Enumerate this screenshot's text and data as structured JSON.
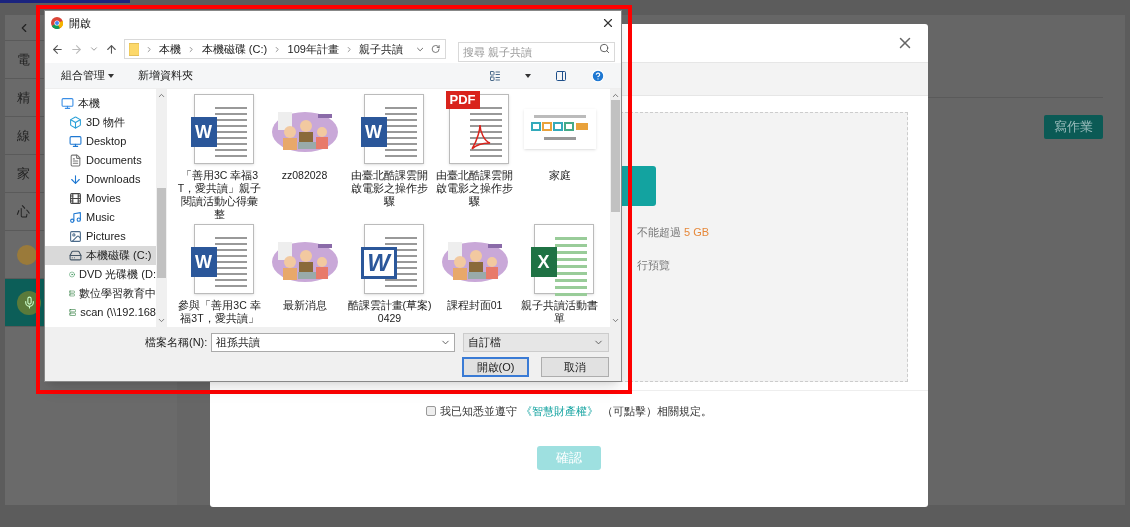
{
  "sidebar": [
    {
      "label": "電",
      "kind": "text",
      "selected": false
    },
    {
      "label": "精",
      "kind": "text",
      "selected": false
    },
    {
      "label": "線",
      "kind": "text",
      "selected": false
    },
    {
      "label": "家",
      "kind": "text",
      "selected": false
    },
    {
      "label": "心",
      "kind": "text",
      "selected": false
    },
    {
      "kind": "badge",
      "selected": false
    },
    {
      "kind": "mic",
      "selected": true
    }
  ],
  "write_button": "寫作業",
  "modal": {
    "upload_note": "不能超過",
    "upload_limit": "5 GB",
    "preview_note": "行預覽",
    "agreement": {
      "checked": false,
      "before": "我已知悉並遵守",
      "link": "《智慧財產權》",
      "after": "（可點擊）相關規定。"
    },
    "confirm": {
      "label": "確認",
      "disabled": true
    }
  },
  "file_dialog": {
    "title": "開啟",
    "path": [
      "本機",
      "本機磁碟 (C:)",
      "109年計畫",
      "親子共讀"
    ],
    "search_placeholder": "搜尋 親子共讀",
    "toolbar": {
      "organize": "組合管理",
      "new_folder": "新增資料夾"
    },
    "tree": [
      {
        "label": "本機",
        "kind": "computer",
        "selected": false,
        "children": [
          {
            "label": "3D 物件",
            "kind": "cube",
            "selected": false
          },
          {
            "label": "Desktop",
            "kind": "desktop",
            "selected": false
          },
          {
            "label": "Documents",
            "kind": "documents",
            "selected": false
          },
          {
            "label": "Downloads",
            "kind": "downloads",
            "selected": false
          },
          {
            "label": "Movies",
            "kind": "movies",
            "selected": false
          },
          {
            "label": "Music",
            "kind": "music",
            "selected": false
          },
          {
            "label": "Pictures",
            "kind": "pictures",
            "selected": false
          },
          {
            "label": "本機磁碟 (C:)",
            "kind": "drive",
            "selected": true
          },
          {
            "label": "DVD 光碟機 (D:",
            "kind": "dvd",
            "selected": false
          },
          {
            "label": "數位學習教育中",
            "kind": "network",
            "selected": false
          },
          {
            "label": "scan (\\\\192.168",
            "kind": "network",
            "selected": false
          }
        ]
      }
    ],
    "files": [
      {
        "name": "「善用3C 幸福3T，愛共讀」親子閱讀活動心得彙整",
        "kind": "word",
        "badge": "W"
      },
      {
        "name": "zz082028",
        "kind": "picture"
      },
      {
        "name": "由臺北酷課雲開啟電影之操作步驟",
        "kind": "word",
        "badge": "W"
      },
      {
        "name": "由臺北酷課雲開啟電影之操作步驟",
        "kind": "pdf",
        "badge": "PDF"
      },
      {
        "name": "家庭",
        "kind": "logo"
      },
      {
        "name": "參與「善用3C 幸福3T，愛共讀」",
        "kind": "word",
        "badge": "W"
      },
      {
        "name": "最新消息",
        "kind": "picture"
      },
      {
        "name": "酷課雲計畫(草案)0429",
        "kind": "word-classic",
        "badge": "W"
      },
      {
        "name": "課程封面01",
        "kind": "picture"
      },
      {
        "name": "親子共讀活動書單",
        "kind": "excel",
        "badge": "X"
      }
    ],
    "file_name_label": "檔案名稱(N):",
    "file_name": "祖孫共讀",
    "filter": "自訂檔",
    "open_button": "開啟(O)",
    "cancel_button": "取消"
  }
}
